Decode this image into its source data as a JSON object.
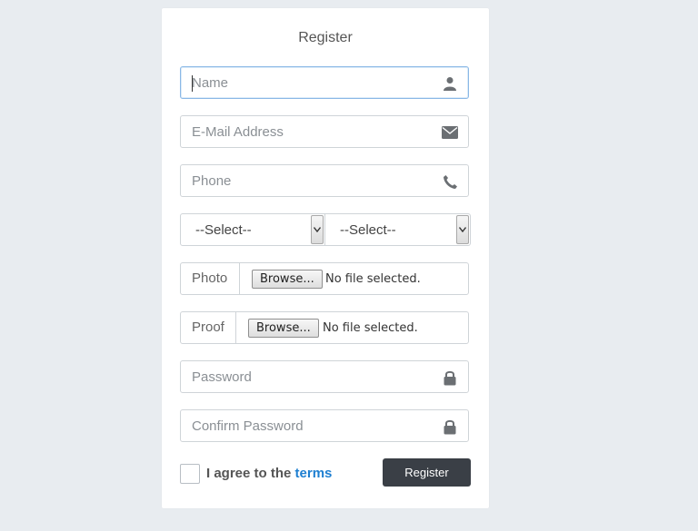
{
  "form": {
    "title": "Register",
    "name_placeholder": "Name",
    "email_placeholder": "E-Mail Address",
    "phone_placeholder": "Phone",
    "select1_value": "--Select--",
    "select2_value": "--Select--",
    "photo_label": "Photo",
    "proof_label": "Proof",
    "browse_label": "Browse...",
    "no_file_text": "No file selected.",
    "password_placeholder": "Password",
    "confirm_password_placeholder": "Confirm Password",
    "agree_text": "I agree to the ",
    "terms_link": "terms",
    "register_button": "Register"
  },
  "icons": {
    "name": "user-icon",
    "email": "envelope-icon",
    "phone": "phone-icon",
    "password": "lock-icon",
    "confirm_password": "lock-icon"
  },
  "colors": {
    "background": "#e8ecf0",
    "button": "#3a3f46",
    "link": "#1e7fd1",
    "focus_border": "#8ab8e6"
  }
}
